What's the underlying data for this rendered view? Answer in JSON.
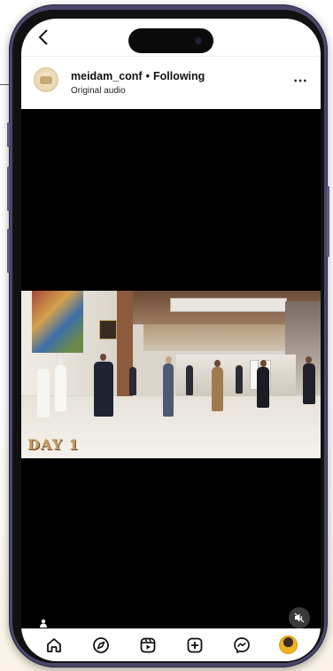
{
  "post": {
    "username": "meidam_conf",
    "separator": "•",
    "follow_status": "Following",
    "audio": "Original audio",
    "more_label": "⋯"
  },
  "video": {
    "overlay_text": "DAY 1"
  },
  "icons": {
    "back": "chevron-left-icon",
    "home": "home-icon",
    "explore": "compass-icon",
    "reels": "reels-icon",
    "create": "plus-square-icon",
    "messages": "messenger-icon",
    "profile": "profile-avatar",
    "mute": "speaker-muted-icon",
    "tags": "user-tag-icon"
  },
  "colors": {
    "phone_frame": "#4a476a",
    "overlay_text": "#c79a5e",
    "profile_ring": "#f0b21e"
  }
}
